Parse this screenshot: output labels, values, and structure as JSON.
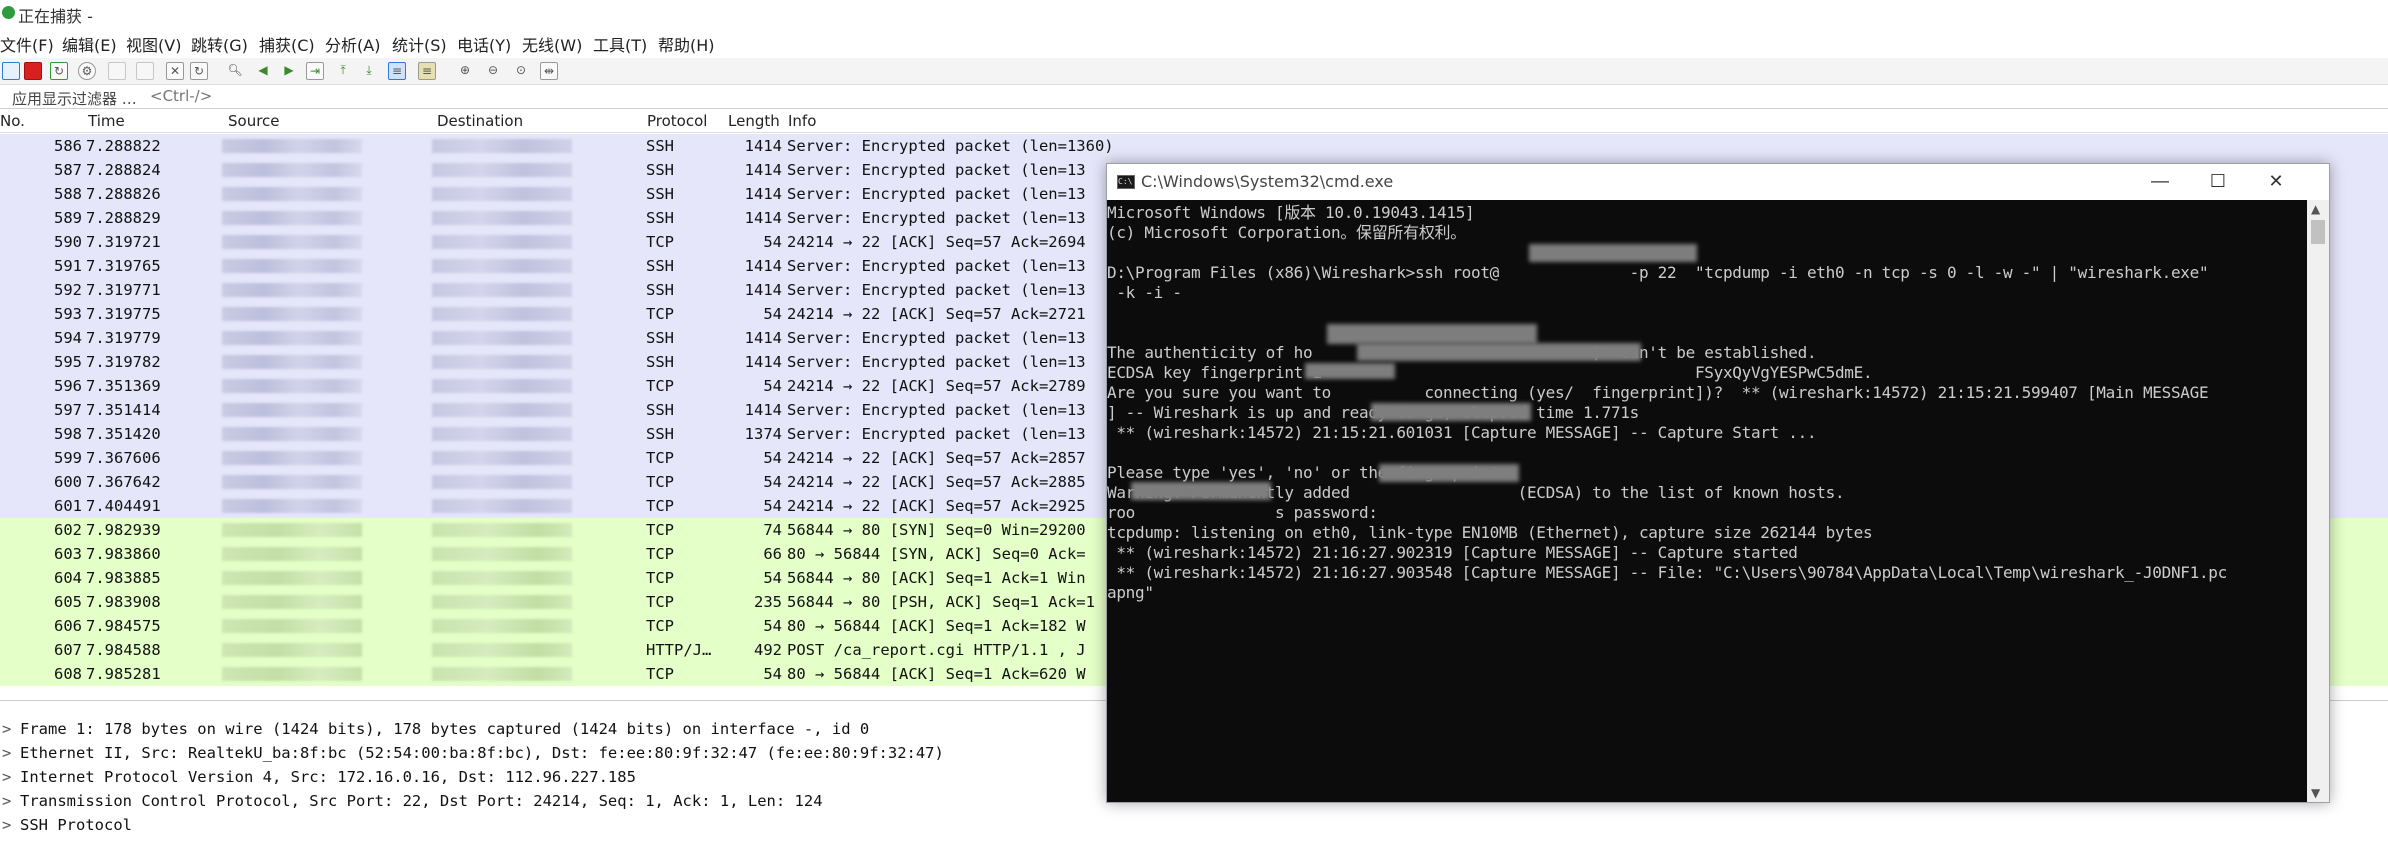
{
  "wireshark": {
    "title": "正在捕获 -",
    "menu": [
      "文件(F)",
      "编辑(E)",
      "视图(V)",
      "跳转(G)",
      "捕获(C)",
      "分析(A)",
      "统计(S)",
      "电话(Y)",
      "无线(W)",
      "工具(T)",
      "帮助(H)"
    ],
    "filter": {
      "label": "应用显示过滤器 …",
      "placeholder": "<Ctrl-/>"
    },
    "columns": [
      "No.",
      "Time",
      "Source",
      "Destination",
      "Protocol",
      "Length",
      "Info"
    ],
    "packets": [
      {
        "no": "586",
        "time": "7.288822",
        "proto": "SSH",
        "len": "1414",
        "info": "Server: Encrypted packet (len=1360)",
        "kind": "ssh"
      },
      {
        "no": "587",
        "time": "7.288824",
        "proto": "SSH",
        "len": "1414",
        "info": "Server: Encrypted packet (len=13",
        "kind": "ssh"
      },
      {
        "no": "588",
        "time": "7.288826",
        "proto": "SSH",
        "len": "1414",
        "info": "Server: Encrypted packet (len=13",
        "kind": "ssh"
      },
      {
        "no": "589",
        "time": "7.288829",
        "proto": "SSH",
        "len": "1414",
        "info": "Server: Encrypted packet (len=13",
        "kind": "ssh"
      },
      {
        "no": "590",
        "time": "7.319721",
        "proto": "TCP",
        "len": "54",
        "info": "24214 → 22 [ACK] Seq=57 Ack=2694",
        "kind": "tcp"
      },
      {
        "no": "591",
        "time": "7.319765",
        "proto": "SSH",
        "len": "1414",
        "info": "Server: Encrypted packet (len=13",
        "kind": "ssh"
      },
      {
        "no": "592",
        "time": "7.319771",
        "proto": "SSH",
        "len": "1414",
        "info": "Server: Encrypted packet (len=13",
        "kind": "ssh"
      },
      {
        "no": "593",
        "time": "7.319775",
        "proto": "TCP",
        "len": "54",
        "info": "24214 → 22 [ACK] Seq=57 Ack=2721",
        "kind": "tcp"
      },
      {
        "no": "594",
        "time": "7.319779",
        "proto": "SSH",
        "len": "1414",
        "info": "Server: Encrypted packet (len=13",
        "kind": "ssh"
      },
      {
        "no": "595",
        "time": "7.319782",
        "proto": "SSH",
        "len": "1414",
        "info": "Server: Encrypted packet (len=13",
        "kind": "ssh"
      },
      {
        "no": "596",
        "time": "7.351369",
        "proto": "TCP",
        "len": "54",
        "info": "24214 → 22 [ACK] Seq=57 Ack=2789",
        "kind": "tcp"
      },
      {
        "no": "597",
        "time": "7.351414",
        "proto": "SSH",
        "len": "1414",
        "info": "Server: Encrypted packet (len=13",
        "kind": "ssh"
      },
      {
        "no": "598",
        "time": "7.351420",
        "proto": "SSH",
        "len": "1374",
        "info": "Server: Encrypted packet (len=13",
        "kind": "ssh"
      },
      {
        "no": "599",
        "time": "7.367606",
        "proto": "TCP",
        "len": "54",
        "info": "24214 → 22 [ACK] Seq=57 Ack=2857",
        "kind": "tcp"
      },
      {
        "no": "600",
        "time": "7.367642",
        "proto": "TCP",
        "len": "54",
        "info": "24214 → 22 [ACK] Seq=57 Ack=2885",
        "kind": "tcp"
      },
      {
        "no": "601",
        "time": "7.404491",
        "proto": "TCP",
        "len": "54",
        "info": "24214 → 22 [ACK] Seq=57 Ack=2925",
        "kind": "tcp"
      },
      {
        "no": "602",
        "time": "7.982939",
        "proto": "TCP",
        "len": "74",
        "info": "56844 → 80 [SYN] Seq=0 Win=29200",
        "kind": "http"
      },
      {
        "no": "603",
        "time": "7.983860",
        "proto": "TCP",
        "len": "66",
        "info": "80 → 56844 [SYN, ACK] Seq=0 Ack=",
        "kind": "http"
      },
      {
        "no": "604",
        "time": "7.983885",
        "proto": "TCP",
        "len": "54",
        "info": "56844 → 80 [ACK] Seq=1 Ack=1 Win",
        "kind": "http"
      },
      {
        "no": "605",
        "time": "7.983908",
        "proto": "TCP",
        "len": "235",
        "info": "56844 → 80 [PSH, ACK] Seq=1 Ack=1",
        "kind": "http"
      },
      {
        "no": "606",
        "time": "7.984575",
        "proto": "TCP",
        "len": "54",
        "info": "80 → 56844 [ACK] Seq=1 Ack=182 W",
        "kind": "http"
      },
      {
        "no": "607",
        "time": "7.984588",
        "proto": "HTTP/J…",
        "len": "492",
        "info": "POST /ca_report.cgi HTTP/1.1 , J",
        "kind": "http"
      },
      {
        "no": "608",
        "time": "7.985281",
        "proto": "TCP",
        "len": "54",
        "info": "80 → 56844 [ACK] Seq=1 Ack=620 W",
        "kind": "http"
      }
    ],
    "details": [
      "Frame 1: 178 bytes on wire (1424 bits), 178 bytes captured (1424 bits) on interface -, id 0",
      "Ethernet II, Src: RealtekU_ba:8f:bc (52:54:00:ba:8f:bc), Dst: fe:ee:80:9f:32:47 (fe:ee:80:9f:32:47)",
      "Internet Protocol Version 4, Src: 172.16.0.16, Dst: 112.96.227.185",
      "Transmission Control Protocol, Src Port: 22, Dst Port: 24214, Seq: 1, Ack: 1, Len: 124",
      "SSH Protocol"
    ]
  },
  "cmd": {
    "title": "C:\\Windows\\System32\\cmd.exe",
    "lines": [
      "Microsoft Windows [版本 10.0.19043.1415]",
      "(c) Microsoft Corporation。保留所有权利。",
      "",
      "D:\\Program Files (x86)\\Wireshark>ssh root@              -p 22  \"tcpdump -i eth0 -n tcp -s 0 -l -w -\" | \"wireshark.exe\"",
      " -k -i -",
      "",
      "",
      "The authenticity of ho                              )' can't be established.",
      "ECDSA key fingerprint i                                        FSyxQyVgYESPwC5dmE.",
      "Are you sure you want to          connecting (yes/  fingerprint])?  ** (wireshark:14572) 21:15:21.599407 [Main MESSAGE",
      "] -- Wireshark is up and ready to go, elapsed time 1.771s",
      " ** (wireshark:14572) 21:15:21.601031 [Capture MESSAGE] -- Capture Start ...",
      "",
      "Please type 'yes', 'no' or the fingerprint:",
      "Warning: Permanently added                  (ECDSA) to the list of known hosts.",
      "roo               s password:",
      "tcpdump: listening on eth0, link-type EN10MB (Ethernet), capture size 262144 bytes",
      " ** (wireshark:14572) 21:16:27.902319 [Capture MESSAGE] -- Capture started",
      " ** (wireshark:14572) 21:16:27.903548 [Capture MESSAGE] -- File: \"C:\\Users\\90784\\AppData\\Local\\Temp\\wireshark_-J0DNF1.pc",
      "apng\""
    ]
  }
}
